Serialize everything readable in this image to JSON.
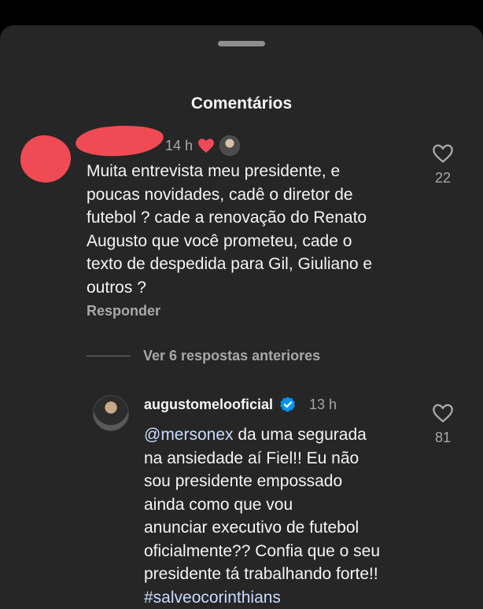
{
  "sheet": {
    "title": "Comentários"
  },
  "comment1": {
    "time": "14 h",
    "text": "Muita entrevista meu presidente, e\npoucas novidades, cadê o diretor de\nfutebol ? cade a renovação do Renato\nAugusto que você prometeu, cade o\ntexto de despedida para Gil, Giuliano e\noutros ?",
    "reply_label": "Responder",
    "likes": "22"
  },
  "view_replies": {
    "label": "Ver 6 respostas anteriores"
  },
  "reply1": {
    "username": "augustomelooficial",
    "time": "13 h",
    "mention": "@mersonex",
    "text_part": " da uma segurada\nna ansiedade aí Fiel!! Eu não\nsou presidente empossado\nainda como que vou\nanunciar executivo de futebol\noficialmente?? Confia que o seu\npresidente tá trabalhando forte!!\n",
    "hashtag": "#salveocorinthians",
    "likes": "81"
  },
  "colors": {
    "sheet_bg": "#262626",
    "secondary_text": "#a8a8a8",
    "like_heart": "#ed4956",
    "verified_blue": "#0095f6",
    "link_text": "#c9dcff",
    "redaction": "#f04a54"
  },
  "icons": {
    "like": "heart-outline-icon",
    "creator_like": "heart-filled-icon",
    "verified": "verified-badge-icon"
  }
}
